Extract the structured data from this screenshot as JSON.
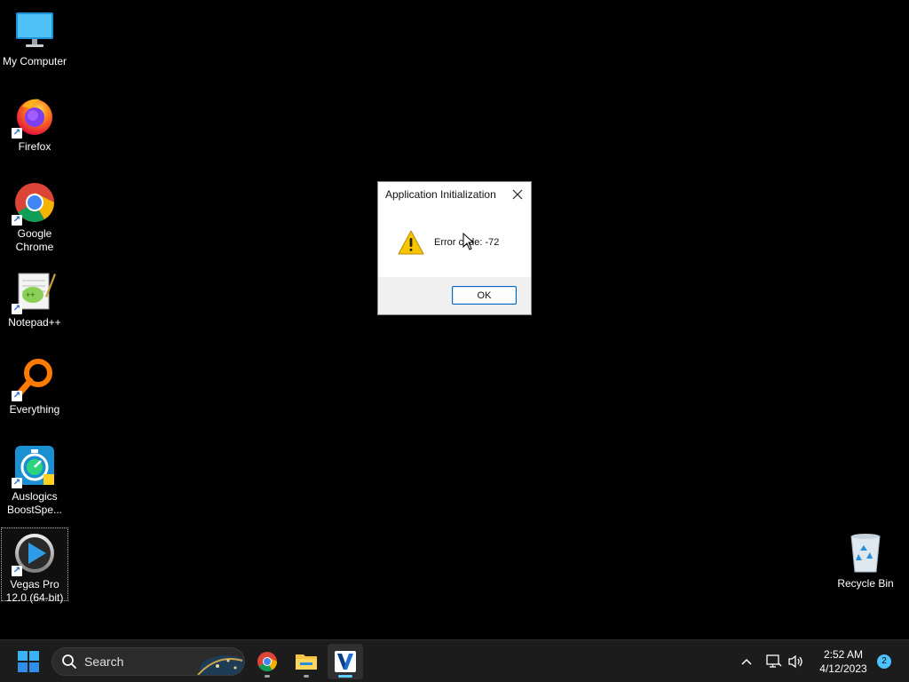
{
  "desktop": {
    "icons": [
      {
        "label": "My Computer",
        "icon": "monitor-icon"
      },
      {
        "label": "Firefox",
        "icon": "firefox-icon"
      },
      {
        "label": "Google Chrome",
        "icon": "chrome-icon"
      },
      {
        "label": "Notepad++",
        "icon": "notepadpp-icon"
      },
      {
        "label": "Everything",
        "icon": "everything-icon"
      },
      {
        "label": "Auslogics BoostSpe...",
        "icon": "auslogics-icon"
      },
      {
        "label": "Vegas Pro 12.0 (64-bit)",
        "icon": "vegas-icon"
      },
      {
        "label": "Recycle Bin",
        "icon": "recycle-bin-icon"
      }
    ]
  },
  "dialog": {
    "title": "Application Initialization",
    "message": "Error code: -72",
    "ok_label": "OK",
    "icon": "warning-icon"
  },
  "taskbar": {
    "search_label": "Search",
    "clock_time": "2:52 AM",
    "clock_date": "4/12/2023",
    "notification_count": "2",
    "apps": [
      "chrome-icon",
      "file-explorer-icon",
      "vegas-icon"
    ]
  },
  "colors": {
    "accent": "#0067c0",
    "taskbar_bg": "#1c1c1c",
    "active_indicator": "#60cdff",
    "warning": "#f7c600"
  }
}
